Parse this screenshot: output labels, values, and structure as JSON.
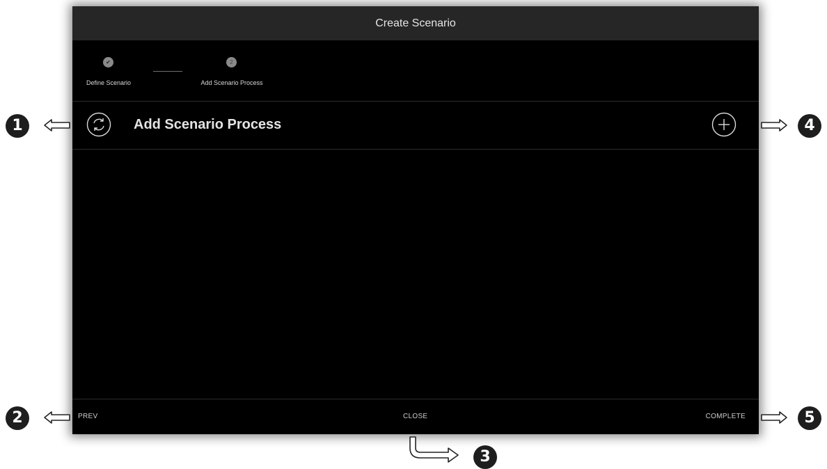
{
  "dialog": {
    "title": "Create Scenario",
    "steps": [
      {
        "label": "Define Scenario",
        "marker": "✔",
        "state": "completed"
      },
      {
        "label": "Add Scenario Process",
        "marker": "2",
        "state": "active"
      }
    ],
    "section": {
      "title": "Add Scenario Process",
      "icon": "refresh-cycle-icon",
      "action_icon": "plus-circle-icon"
    },
    "footer": {
      "prev_label": "PREV",
      "close_label": "CLOSE",
      "complete_label": "COMPLETE"
    }
  },
  "callouts": [
    "1",
    "2",
    "3",
    "4",
    "5"
  ],
  "colors": {
    "dialog_bg": "#000000",
    "title_bar_bg": "#262626",
    "text": "#e4e4e4",
    "callout_bg": "#1e1e1e"
  }
}
